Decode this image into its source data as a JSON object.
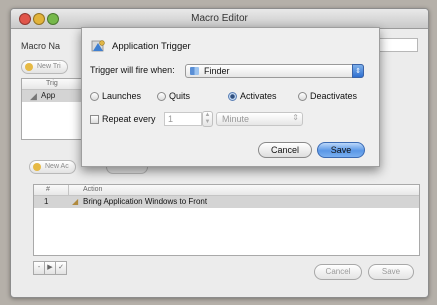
{
  "window": {
    "title": "Macro Editor"
  },
  "editor": {
    "macro_name_label": "Macro Na",
    "new_trigger_label": "New Tri",
    "triggers_header": "Trig",
    "trigger_row_label": "App",
    "new_action_label": "New Ac",
    "actions_table": {
      "columns": [
        "#",
        "Action"
      ],
      "rows": [
        {
          "num": "1",
          "action": "Bring Application Windows to Front"
        }
      ]
    },
    "toolbar_buttons": [
      "-",
      "▶",
      "✓"
    ],
    "cancel_label": "Cancel",
    "save_label": "Save"
  },
  "sheet": {
    "title": "Application Trigger",
    "fire_label": "Trigger will fire when:",
    "app_popup_value": "Finder",
    "options": [
      "Launches",
      "Quits",
      "Activates",
      "Deactivates"
    ],
    "selected_option": "Activates",
    "repeat_label": "Repeat every",
    "repeat_value": "1",
    "repeat_unit": "Minute",
    "cancel_label": "Cancel",
    "save_label": "Save"
  },
  "colors": {
    "default_button": "#5a97e6",
    "selection": "#d4d4d4"
  }
}
